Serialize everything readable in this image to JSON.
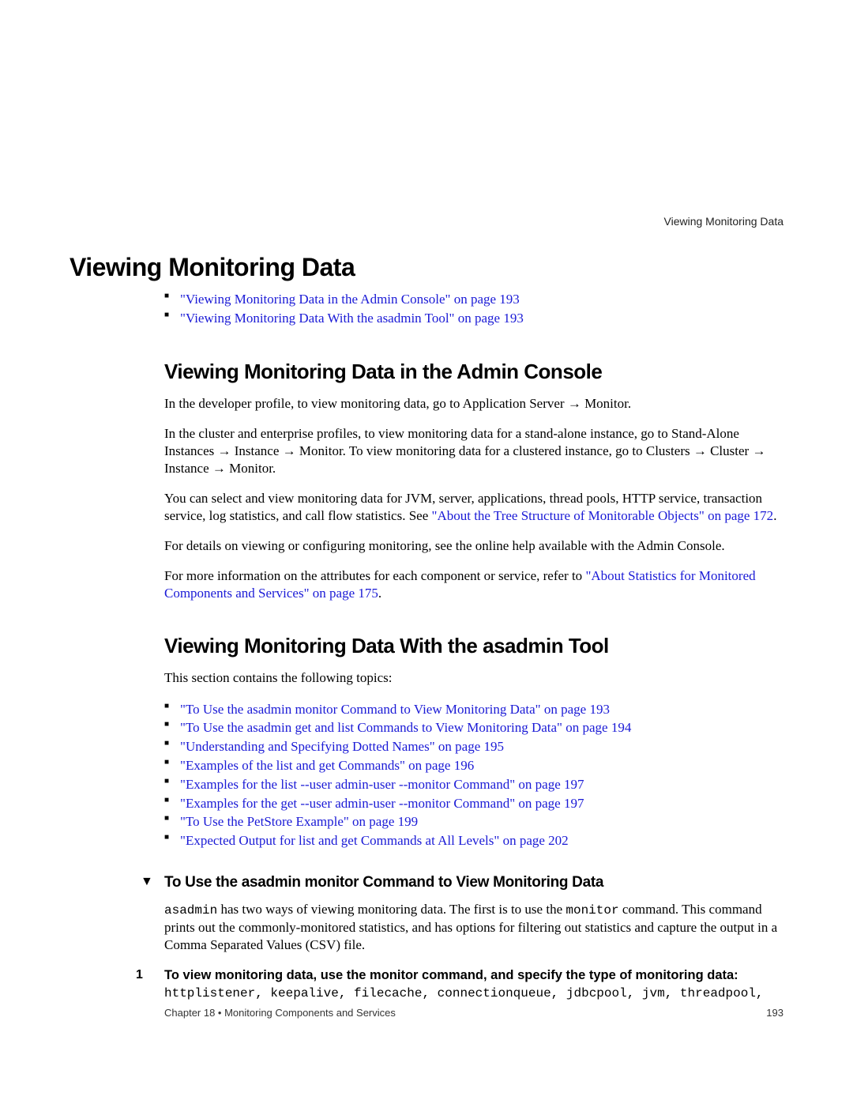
{
  "header_right": "Viewing Monitoring Data",
  "h1": "Viewing Monitoring Data",
  "top_links": [
    "\"Viewing Monitoring Data in the Admin Console\" on page 193",
    "\"Viewing Monitoring Data With the asadmin Tool\" on page 193"
  ],
  "section1": {
    "heading": "Viewing Monitoring Data in the Admin Console",
    "p1": "In the developer profile, to view monitoring data, go to Application Server → Monitor.",
    "p2": "In the cluster and enterprise profiles, to view monitoring data for a stand-alone instance, go to Stand-Alone Instances → Instance → Monitor. To view monitoring data for a clustered instance, go to Clusters → Cluster → Instance → Monitor.",
    "p3a": "You can select and view monitoring data for JVM, server, applications, thread pools, HTTP service, transaction service, log statistics, and call flow statistics. See ",
    "p3_link": "\"About the Tree Structure of Monitorable Objects\" on page 172",
    "p3b": ".",
    "p4": "For details on viewing or configuring monitoring, see the online help available with the Admin Console.",
    "p5a": "For more information on the attributes for each component or service, refer to ",
    "p5_link": "\"About Statistics for Monitored Components and Services\" on page 175",
    "p5b": "."
  },
  "section2": {
    "heading": "Viewing Monitoring Data With the asadmin Tool",
    "intro": "This section contains the following topics:",
    "links": [
      "\"To Use the asadmin monitor Command to View Monitoring Data\" on page 193",
      "\"To Use the asadmin get and list Commands to View Monitoring Data\" on page 194",
      "\"Understanding and Specifying Dotted Names\" on page 195",
      "\"Examples of the list and get Commands\" on page 196",
      "\"Examples for the list --user admin-user --monitor Command\" on page 197",
      "\"Examples for the get --user admin-user --monitor Command\" on page 197",
      "\"To Use the PetStore Example\" on page 199",
      "\"Expected Output for list and get Commands at All Levels\" on page 202"
    ]
  },
  "section3": {
    "marker": "▼",
    "heading": "To Use the asadmin monitor Command to View Monitoring Data",
    "p1_mono1": "asadmin",
    "p1_mid": " has two ways of viewing monitoring data. The first is to use the ",
    "p1_mono2": "monitor",
    "p1_end": " command. This command prints out the commonly-monitored statistics, and has options for filtering out statistics and capture the output in a Comma Separated Values (CSV) file.",
    "step1_num": "1",
    "step1_title": "To view monitoring data, use the monitor command, and specify the type of monitoring data:",
    "step1_body": "httplistener, keepalive, filecache, connectionqueue, jdbcpool, jvm, threadpool,"
  },
  "footer": {
    "left": "Chapter 18 • Monitoring Components and Services",
    "right": "193"
  }
}
